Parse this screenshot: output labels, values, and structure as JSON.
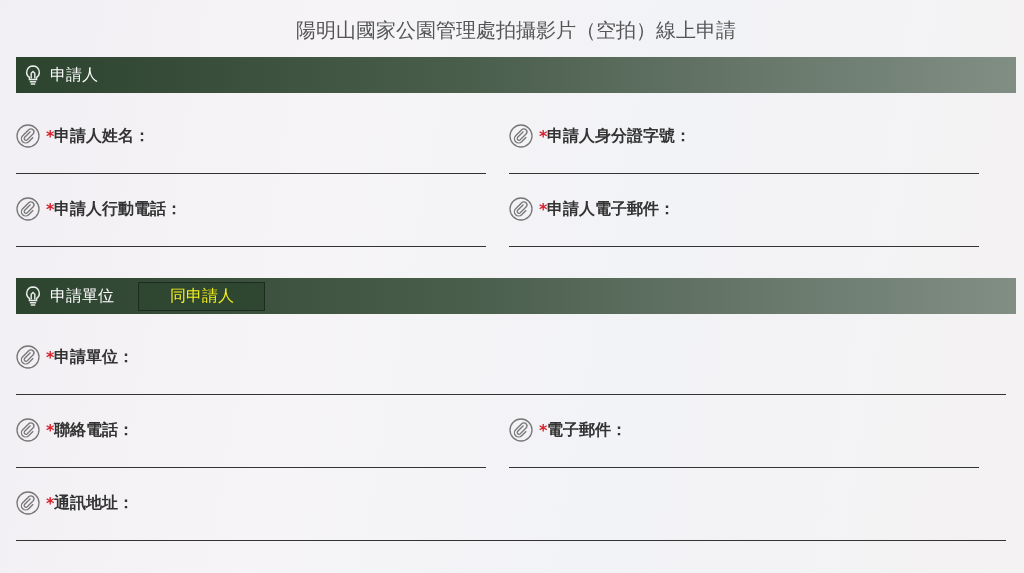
{
  "title": "陽明山國家公園管理處拍攝影片（空拍）線上申請",
  "sections": [
    {
      "title": "申請人",
      "rows": [
        [
          {
            "mark": "*",
            "label": "申請人姓名："
          },
          {
            "mark": "*",
            "label": "申請人身分證字號："
          }
        ],
        [
          {
            "mark": "*",
            "label": "申請人行動電話："
          },
          {
            "mark": "*",
            "label": "申請人電子郵件："
          }
        ]
      ]
    },
    {
      "title": "申請單位",
      "button": "同申請人",
      "rows": [
        [
          {
            "mark": "*",
            "label": "申請單位："
          }
        ],
        [
          {
            "mark": "*",
            "label": "聯絡電話："
          },
          {
            "mark": "*",
            "label": "電子郵件："
          }
        ],
        [
          {
            "mark": "*",
            "label": "通訊地址："
          }
        ]
      ]
    }
  ]
}
